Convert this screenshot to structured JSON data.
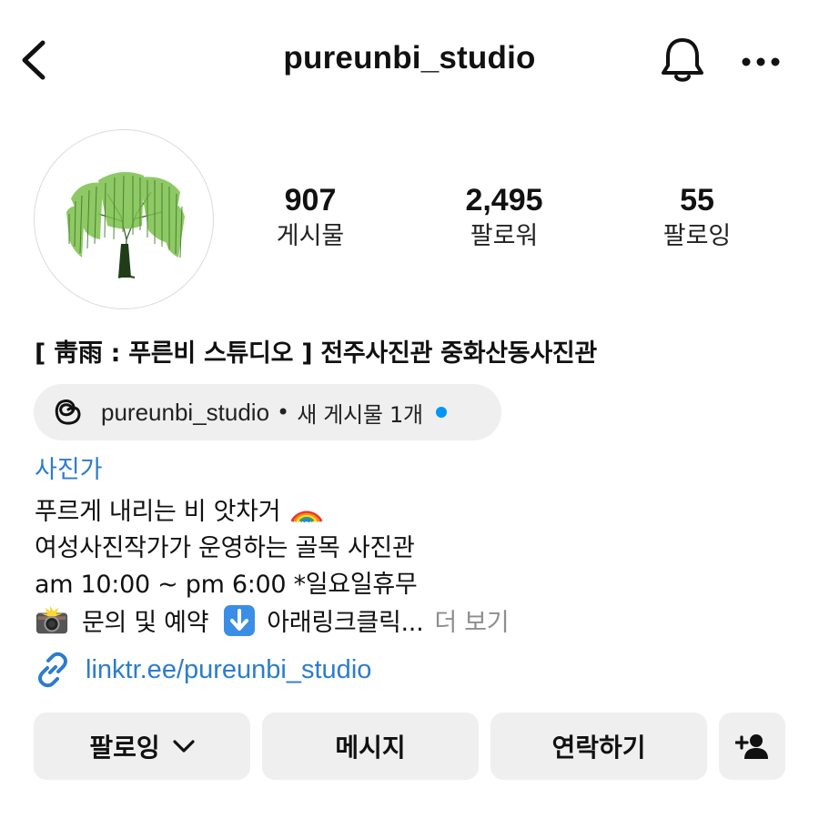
{
  "header": {
    "username": "pureunbi_studio",
    "back_icon": "chevron-left-icon",
    "bell_icon": "bell-icon",
    "more_icon": "more-horizontal-icon"
  },
  "profile": {
    "avatar_icon": "willow-tree-icon",
    "stats": {
      "posts": {
        "value": "907",
        "label": "게시물"
      },
      "followers": {
        "value": "2,495",
        "label": "팔로워"
      },
      "following": {
        "value": "55",
        "label": "팔로잉"
      }
    },
    "name": "[ 靑雨 : 푸른비 스튜디오 ] 전주사진관 중화산동사진관"
  },
  "threads": {
    "icon": "threads-icon",
    "handle": "pureunbi_studio",
    "separator": "•",
    "new_posts": "새 게시물 1개",
    "dot_color": "#0095f6"
  },
  "bio": {
    "category": "사진가",
    "line1": "푸르게 내리는 비 앗차거",
    "line1_emoji": "rainbow-icon",
    "line2": "여성사진작가가 운영하는 골목 사진관",
    "line3": "am 10:00 ~ pm 6:00 *일요일휴무",
    "line4_part1": "문의 및 예약",
    "line4_part2": "아래링크클릭...",
    "line4_emoji1": "camera-flash-icon",
    "line4_emoji2": "down-arrow-icon",
    "more": "더 보기"
  },
  "link": {
    "icon": "link-icon",
    "text": "linktr.ee/pureunbi_studio"
  },
  "actions": {
    "following": "팔로잉",
    "message": "메시지",
    "contact": "연락하기",
    "add_user_icon": "add-person-icon"
  },
  "colors": {
    "accent_link": "#2c7ccc",
    "button_bg": "#efefef",
    "muted": "#8e8e8e"
  }
}
